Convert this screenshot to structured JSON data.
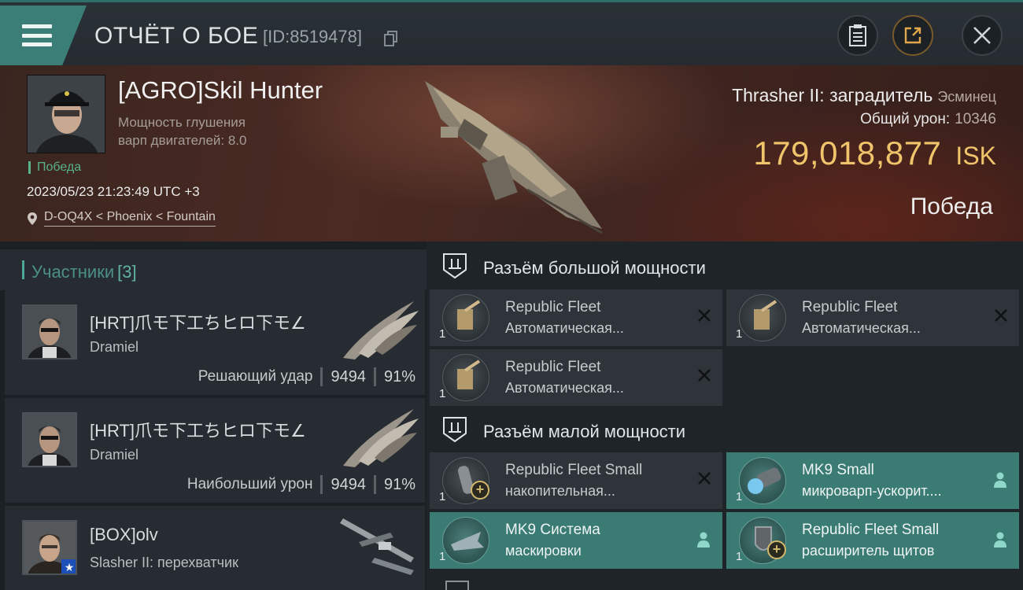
{
  "header": {
    "title": "ОТЧЁТ О БОЕ",
    "report_id": "[ID:8519478]"
  },
  "victim": {
    "name": "[AGRO]Skil Hunter",
    "attribute_line1": "Мощность глушения",
    "attribute_line2": "варп двигателей: 8.0",
    "outcome_tag": "Победа",
    "datetime": "2023/05/23 21:23:49 UTC +3",
    "location": "D-OQ4X < Phoenix < Fountain",
    "ship": "Thrasher II: заградитель",
    "ship_class": "Эсминец",
    "damage_label": "Общий урон:",
    "damage_value": "10346",
    "isk_value": "179,018,877",
    "isk_unit": "ISK",
    "result": "Победа"
  },
  "participants": {
    "label": "Участники",
    "count": "[3]",
    "items": [
      {
        "name": "[HRT]爪モ下工ちヒロ下モ∠",
        "corp": "Dramiel",
        "stat_label": "Решающий удар",
        "damage": "9494",
        "percent": "91%"
      },
      {
        "name": "[HRT]爪モ下工ちヒロ下モ∠",
        "corp": "Dramiel",
        "stat_label": "Наибольший урон",
        "damage": "9494",
        "percent": "91%"
      },
      {
        "name": "[BOX]olv",
        "corp": "Slasher II: перехватчик"
      }
    ]
  },
  "fitting": {
    "high_slots_label": "Разъём большой мощности",
    "low_slots_label": "Разъём малой мощности",
    "high_modules": [
      {
        "line1": "Republic Fleet",
        "line2": "Автоматическая...",
        "qty": "1"
      },
      {
        "line1": "Republic Fleet",
        "line2": "Автоматическая...",
        "qty": "1"
      },
      {
        "line1": "Republic Fleet",
        "line2": "Автоматическая...",
        "qty": "1"
      }
    ],
    "low_modules": [
      {
        "line1": "Republic Fleet Small",
        "line2": "накопительная...",
        "qty": "1"
      },
      {
        "line1": "MK9 Small",
        "line2": "микроварп-ускорит....",
        "qty": "1"
      },
      {
        "line1": "MK9 Система",
        "line2": "маскировки",
        "qty": "1"
      },
      {
        "line1": "Republic Fleet Small",
        "line2": "расширитель щитов",
        "qty": "1"
      }
    ]
  },
  "colors": {
    "accent_teal": "#3a7b74",
    "isk_gold": "#f0c46a",
    "victory_green": "#57b38a"
  },
  "icons": [
    "menu-icon",
    "copy-icon",
    "report-icon",
    "share-icon",
    "close-icon",
    "location-pin-icon",
    "high-slot-icon",
    "low-slot-icon",
    "remove-x-icon",
    "pilot-icon",
    "plus-badge-icon",
    "star-icon"
  ]
}
